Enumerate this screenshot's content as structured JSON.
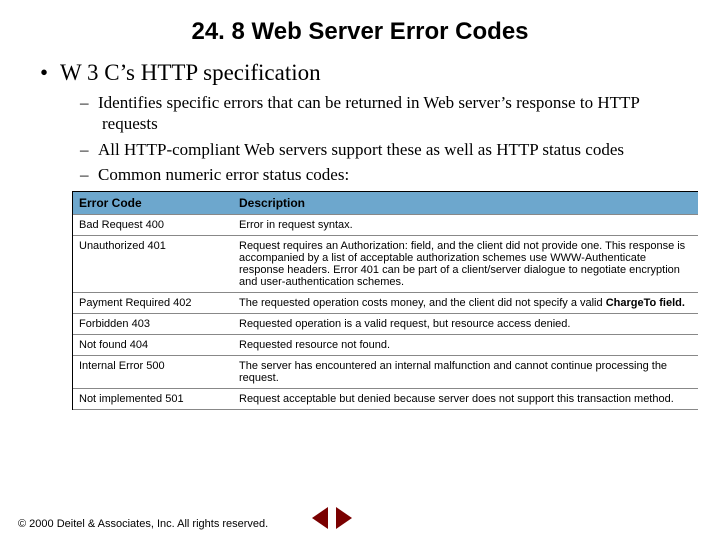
{
  "title": "24. 8 Web Server Error Codes",
  "bullet1": "W 3 C’s HTTP specification",
  "sub1": "Identifies specific errors that can be returned in Web server’s response to HTTP requests",
  "sub2": "All HTTP-compliant Web servers support these as well as HTTP status codes",
  "sub3": "Common numeric error status codes:",
  "table": {
    "h1": "Error Code",
    "h2": "Description",
    "rows": [
      {
        "code": "Bad Request 400",
        "desc": "Error in request syntax."
      },
      {
        "code": "Unauthorized 401",
        "desc": "Request requires an Authorization: field, and the client did not provide one. This response is accompanied by a list of acceptable authorization schemes use WWW-Authenticate response headers. Error 401 can be part of a client/server dialogue to negotiate encryption and user-authentication schemes."
      },
      {
        "code": "Payment Required 402",
        "desc": "The requested operation costs money, and the client did not specify a valid "
      },
      {
        "code402b": "ChargeTo field."
      },
      {
        "code": "Forbidden 403",
        "desc": "Requested operation is a valid request, but resource access denied."
      },
      {
        "code": "Not found 404",
        "desc": "Requested resource not found."
      },
      {
        "code": "Internal Error 500",
        "desc": "The server has encountered an internal malfunction and cannot continue processing the request."
      },
      {
        "code": "Not implemented 501",
        "desc": "Request acceptable but denied because server does not support this transaction method."
      }
    ]
  },
  "footer": "© 2000 Deitel & Associates, Inc.  All rights reserved."
}
